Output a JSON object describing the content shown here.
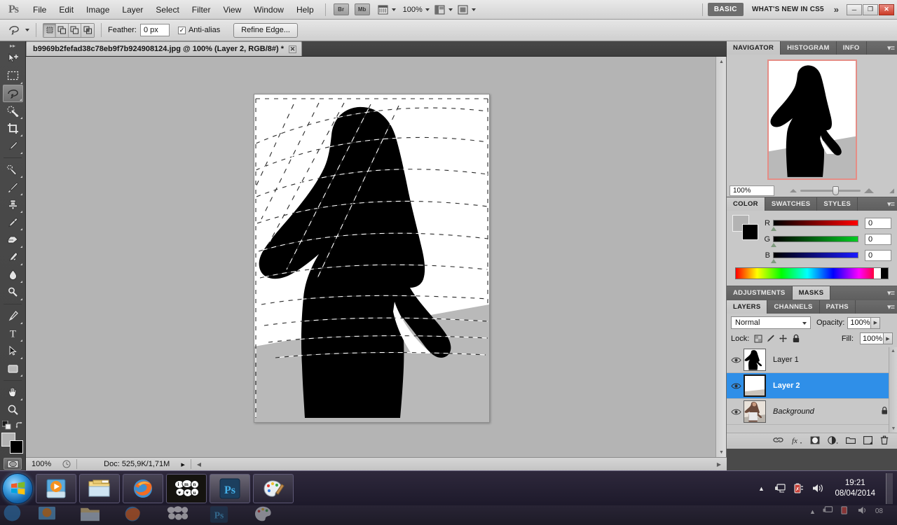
{
  "app": {
    "name": "Adobe Photoshop CS5",
    "logo": "Ps"
  },
  "menubar": {
    "items": [
      "File",
      "Edit",
      "Image",
      "Layer",
      "Select",
      "Filter",
      "View",
      "Window",
      "Help"
    ],
    "bridge_label": "Br",
    "mini_bridge_label": "Mb",
    "zoom_level": "100%",
    "workspace_basic": "BASIC",
    "workspace_new": "WHAT'S NEW IN CS5",
    "more_chevron": "»",
    "window_buttons": {
      "minimize": "─",
      "restore": "❐",
      "close": "✕"
    }
  },
  "optionsbar": {
    "tool_icon": "lasso-icon",
    "selection_modes": [
      "new-selection",
      "add-to-selection",
      "subtract-from-selection",
      "intersect-with-selection"
    ],
    "active_selection_mode": "new-selection",
    "feather_label": "Feather:",
    "feather_value": "0 px",
    "antialias_label": "Anti-alias",
    "antialias_checked": "✓",
    "refine_edge_label": "Refine Edge..."
  },
  "toolbar": {
    "tools": [
      {
        "name": "move-tool",
        "has_submenu": false
      },
      {
        "name": "rectangular-marquee-tool",
        "has_submenu": true
      },
      {
        "name": "lasso-tool",
        "has_submenu": true,
        "selected": true
      },
      {
        "name": "quick-selection-tool",
        "has_submenu": true
      },
      {
        "name": "crop-tool",
        "has_submenu": true
      },
      {
        "name": "eyedropper-tool",
        "has_submenu": true
      },
      {
        "name": "spot-healing-brush-tool",
        "has_submenu": true
      },
      {
        "name": "brush-tool",
        "has_submenu": true
      },
      {
        "name": "clone-stamp-tool",
        "has_submenu": true
      },
      {
        "name": "history-brush-tool",
        "has_submenu": true
      },
      {
        "name": "eraser-tool",
        "has_submenu": true
      },
      {
        "name": "gradient-tool",
        "has_submenu": true
      },
      {
        "name": "blur-tool",
        "has_submenu": true
      },
      {
        "name": "dodge-tool",
        "has_submenu": true
      },
      {
        "name": "pen-tool",
        "has_submenu": true
      },
      {
        "name": "type-tool",
        "has_submenu": true
      },
      {
        "name": "path-selection-tool",
        "has_submenu": true
      },
      {
        "name": "rectangle-shape-tool",
        "has_submenu": true
      },
      {
        "name": "hand-tool",
        "has_submenu": true
      },
      {
        "name": "zoom-tool",
        "has_submenu": false
      }
    ],
    "foreground_color": "#b3b3b3",
    "background_color": "#000000",
    "quick_mask_label": "quick-mask-mode"
  },
  "document": {
    "tab_title": "b9969b2fefad38c78eb9f7b924908124.jpg @ 100% (Layer 2, RGB/8#) *",
    "close_glyph": "✕"
  },
  "statusbar": {
    "zoom": "100%",
    "doc_info": "Doc: 525,9K/1,71M",
    "arrow": "▸"
  },
  "navigator_panel": {
    "tabs": [
      "NAVIGATOR",
      "HISTOGRAM",
      "INFO"
    ],
    "active_tab": "NAVIGATOR",
    "zoom_value": "100%",
    "view_box_color": "#e58d86",
    "menu_glyph": "≡"
  },
  "color_panel": {
    "tabs": [
      "COLOR",
      "SWATCHES",
      "STYLES"
    ],
    "active_tab": "COLOR",
    "channels": [
      {
        "letter": "R",
        "value": "0"
      },
      {
        "letter": "G",
        "value": "0"
      },
      {
        "letter": "B",
        "value": "0"
      }
    ],
    "foreground_color": "#b3b3b3",
    "background_color": "#000000",
    "menu_glyph": "≡"
  },
  "masks_panel": {
    "tabs": [
      "ADJUSTMENTS",
      "MASKS"
    ],
    "active_tab": "MASKS",
    "menu_glyph": "≡"
  },
  "layers_panel": {
    "tabs": [
      "LAYERS",
      "CHANNELS",
      "PATHS"
    ],
    "active_tab": "LAYERS",
    "menu_glyph": "≡",
    "blend_mode": "Normal",
    "opacity_label": "Opacity:",
    "opacity_value": "100%",
    "lock_label": "Lock:",
    "lock_icons": [
      "lock-transparent-pixels-icon",
      "lock-image-pixels-icon",
      "lock-position-icon",
      "lock-all-icon"
    ],
    "fill_label": "Fill:",
    "fill_value": "100%",
    "layers": [
      {
        "name": "Layer 1",
        "thumb": "silhouette",
        "visible": true,
        "selected": false,
        "locked": false,
        "italic": false
      },
      {
        "name": "Layer 2",
        "thumb": "white-gray",
        "visible": true,
        "selected": true,
        "locked": false,
        "italic": false
      },
      {
        "name": "Background",
        "thumb": "photo",
        "visible": true,
        "selected": false,
        "locked": true,
        "italic": true
      }
    ],
    "footer_buttons": [
      "link-layers-icon",
      "add-layer-style-icon",
      "add-layer-mask-icon",
      "new-adjustment-layer-icon",
      "new-group-icon",
      "new-layer-icon",
      "delete-layer-icon"
    ]
  },
  "taskbar": {
    "start_label": "start-orb",
    "items": [
      {
        "name": "windows-media-player-icon"
      },
      {
        "name": "windows-explorer-icon"
      },
      {
        "name": "firefox-icon"
      },
      {
        "name": "imvu-icon"
      },
      {
        "name": "photoshop-icon"
      },
      {
        "name": "paint-icon"
      }
    ],
    "tray_icons": [
      "show-hidden-icons-icon",
      "network-icon",
      "battery-icon",
      "volume-icon"
    ],
    "time": "19:21",
    "date": "08/04/2014"
  },
  "colors": {
    "selection_blue": "#2f8fe8",
    "canvas_bg": "#b4b4b4",
    "panel_bg": "#c8c8c8",
    "chrome_dark": "#4a4a4a"
  }
}
